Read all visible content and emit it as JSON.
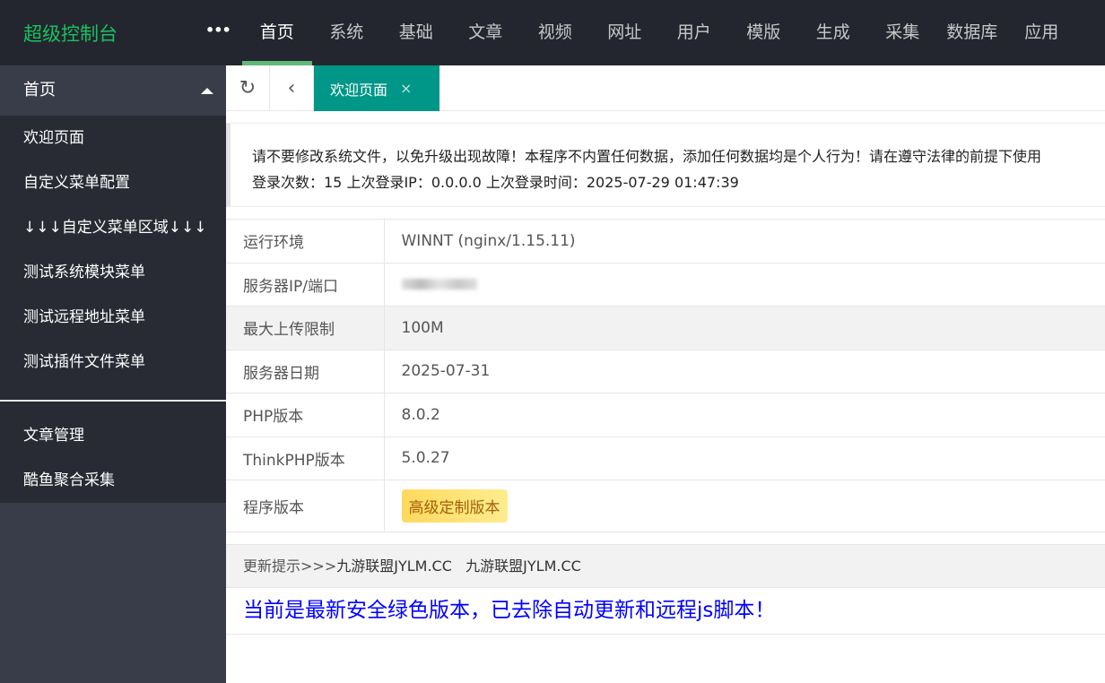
{
  "header": {
    "logo": "超级控制台",
    "more": "•••",
    "nav": [
      "首页",
      "系统",
      "基础",
      "文章",
      "视频",
      "网址",
      "用户",
      "模版",
      "生成",
      "采集",
      "数据库",
      "应用"
    ]
  },
  "sidebar": {
    "head": "首页",
    "items": [
      "欢迎页面",
      "自定义菜单配置",
      "↓↓↓自定义菜单区域↓↓↓",
      "测试系统模块菜单",
      "测试远程地址菜单",
      "测试插件文件菜单"
    ],
    "items2": [
      "文章管理",
      "酷鱼聚合采集"
    ]
  },
  "tabs": {
    "active": "欢迎页面",
    "close": "×"
  },
  "notice": {
    "line1": "请不要修改系统文件，以免升级出现故障！本程序不内置任何数据，添加任何数据均是个人行为！请在遵守法律的前提下使用",
    "line2": "登录次数：15 上次登录IP：0.0.0.0 上次登录时间：2025-07-29 01:47:39"
  },
  "info": [
    {
      "label": "运行环境",
      "value": "WINNT (nginx/1.15.11)"
    },
    {
      "label": "服务器IP/端口",
      "value": ""
    },
    {
      "label": "最大上传限制",
      "value": "100M"
    },
    {
      "label": "服务器日期",
      "value": "2025-07-31"
    },
    {
      "label": "PHP版本",
      "value": "8.0.2"
    },
    {
      "label": "ThinkPHP版本",
      "value": "5.0.27"
    },
    {
      "label": "程序版本",
      "value": "高级定制版本"
    }
  ],
  "update": {
    "prefix": "更新提示>>>",
    "link1": "九游联盟JYLM.CC",
    "link2": "九游联盟JYLM.CC"
  },
  "message": "当前是最新安全绿色版本，已去除自动更新和远程js脚本！"
}
